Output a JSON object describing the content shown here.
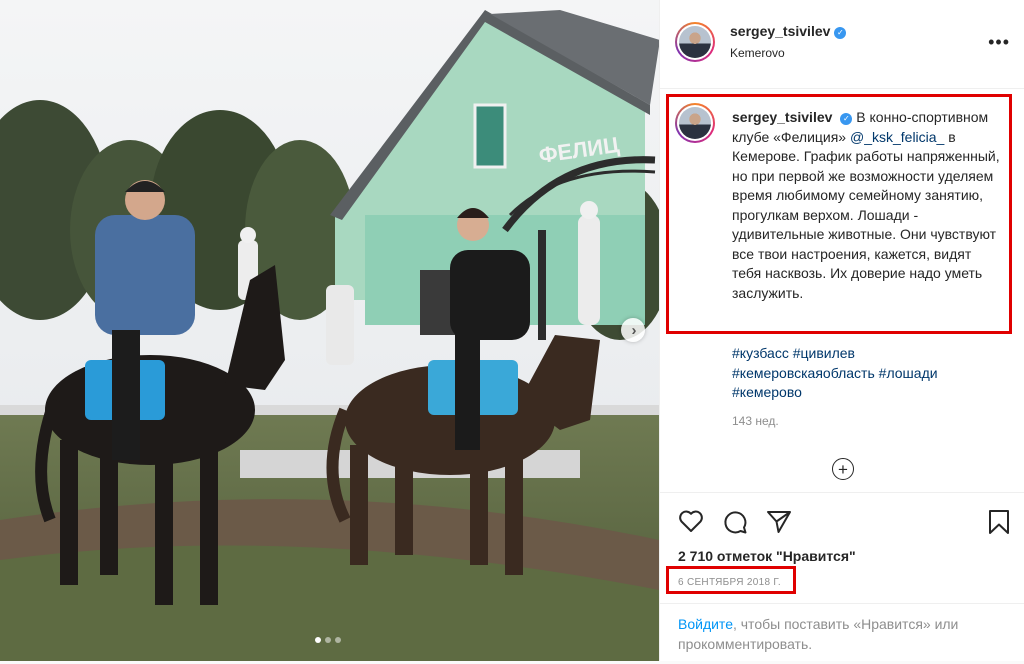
{
  "post": {
    "username": "sergey_tsivilev",
    "verified_icon": "verified-badge-icon",
    "location": "Kemerovo",
    "more_icon": "ellipsis-icon"
  },
  "caption": {
    "username": "sergey_tsivilev",
    "text_before_mention": "В конно-спортивном клубе «Фелиция»",
    "mention": "@_ksk_felicia_",
    "text_after_mention": " в Кемерове. График работы напряженный, но при первой же возможности уделяем время любимому семейному занятию, прогулкам верхом. Лошади - удивительные животные. Они чувствуют все твои настроения, кажется, видят тебя насквозь. Их доверие надо уметь заслужить."
  },
  "hashtags": [
    "#кузбасс",
    "#цивилев",
    "#кемеровскаяобласть",
    "#лошади",
    "#кемерово"
  ],
  "age": "143 нед.",
  "likes": "2 710 отметок \"Нравится\"",
  "date": "6 СЕНТЯБРЯ 2018 Г.",
  "login_prompt": {
    "link": "Войдите",
    "text": ", чтобы поставить «Нравится» или прокомментировать."
  },
  "photo": {
    "sign_text": "ФЕЛИЦ",
    "carousel": {
      "count": 3,
      "active": 0
    }
  },
  "colors": {
    "highlight": "#e00000",
    "link": "#00376b",
    "login_link": "#0095f6",
    "verified": "#3897f0",
    "muted": "#8e8e8e"
  }
}
